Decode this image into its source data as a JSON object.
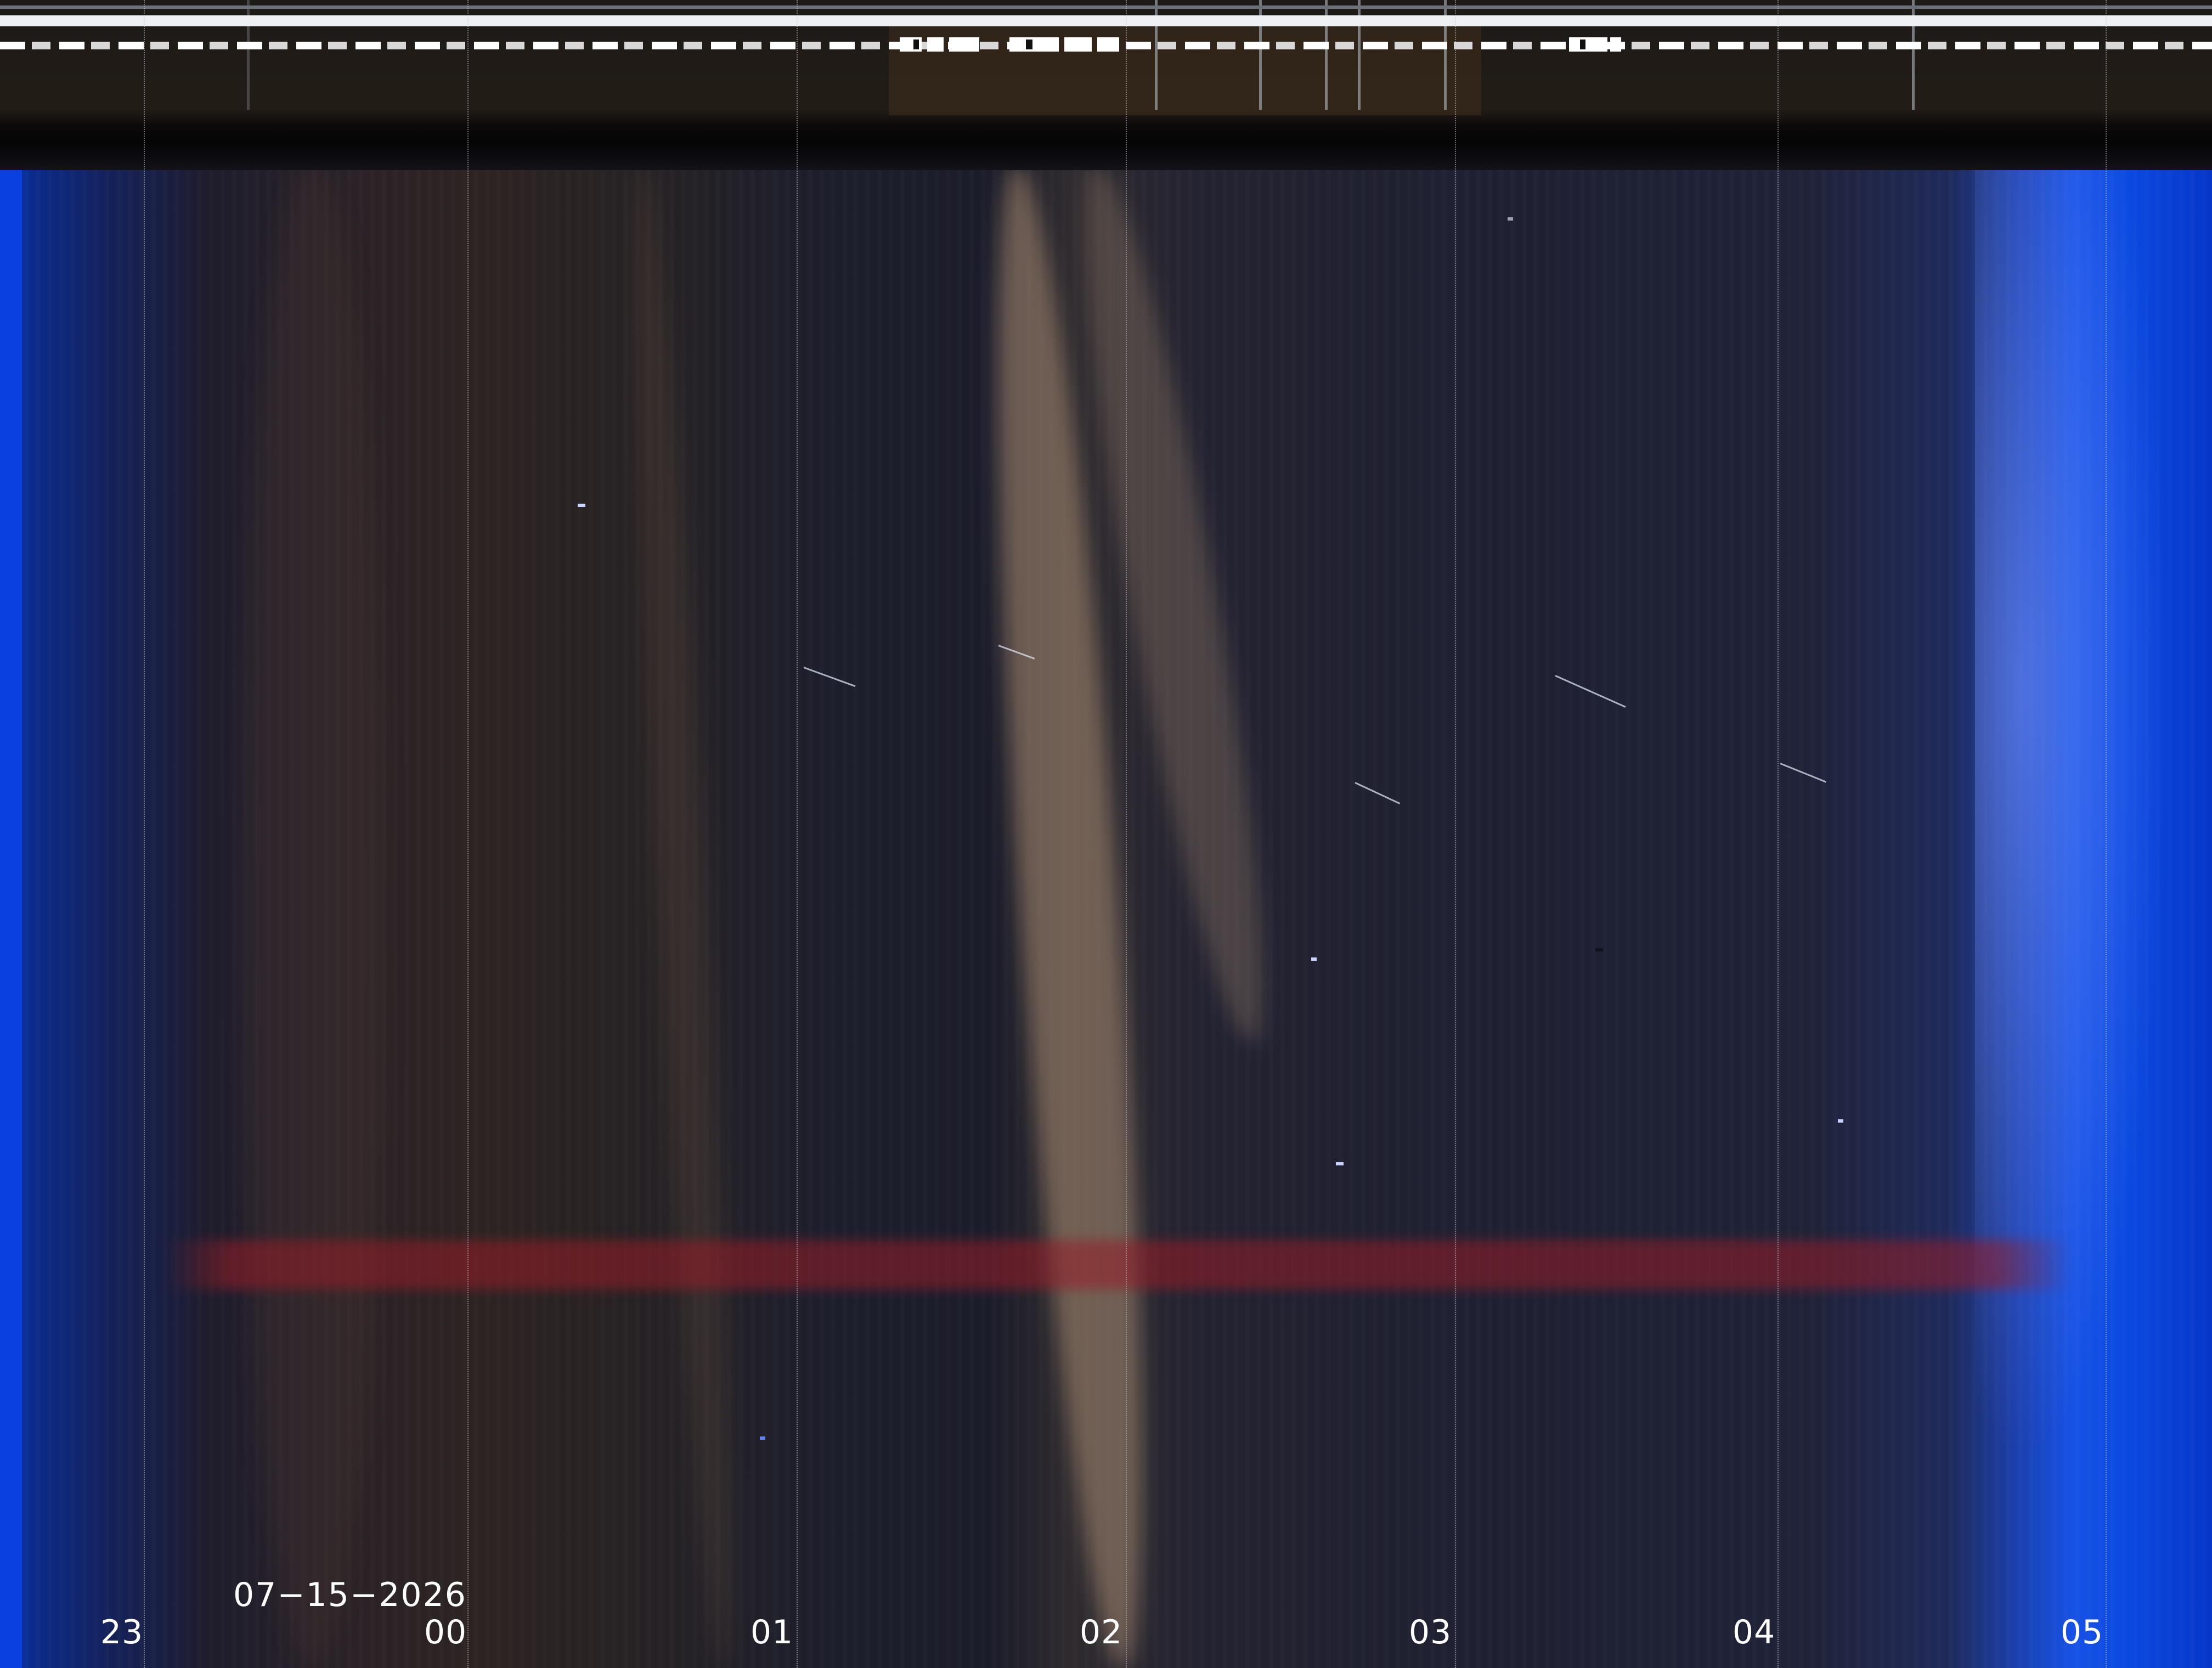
{
  "image": {
    "kind": "keogram",
    "date_label": "07−15−2026",
    "hour_labels": [
      "23",
      "00",
      "01",
      "02",
      "03",
      "04",
      "05"
    ],
    "colors": {
      "dusk_dawn_blue": "#0a48e0",
      "night_sky": "#1c1d2a",
      "warm_glow": "#9a806a",
      "red_band": "#96202a",
      "header_stripe": "#eef0f4"
    }
  }
}
